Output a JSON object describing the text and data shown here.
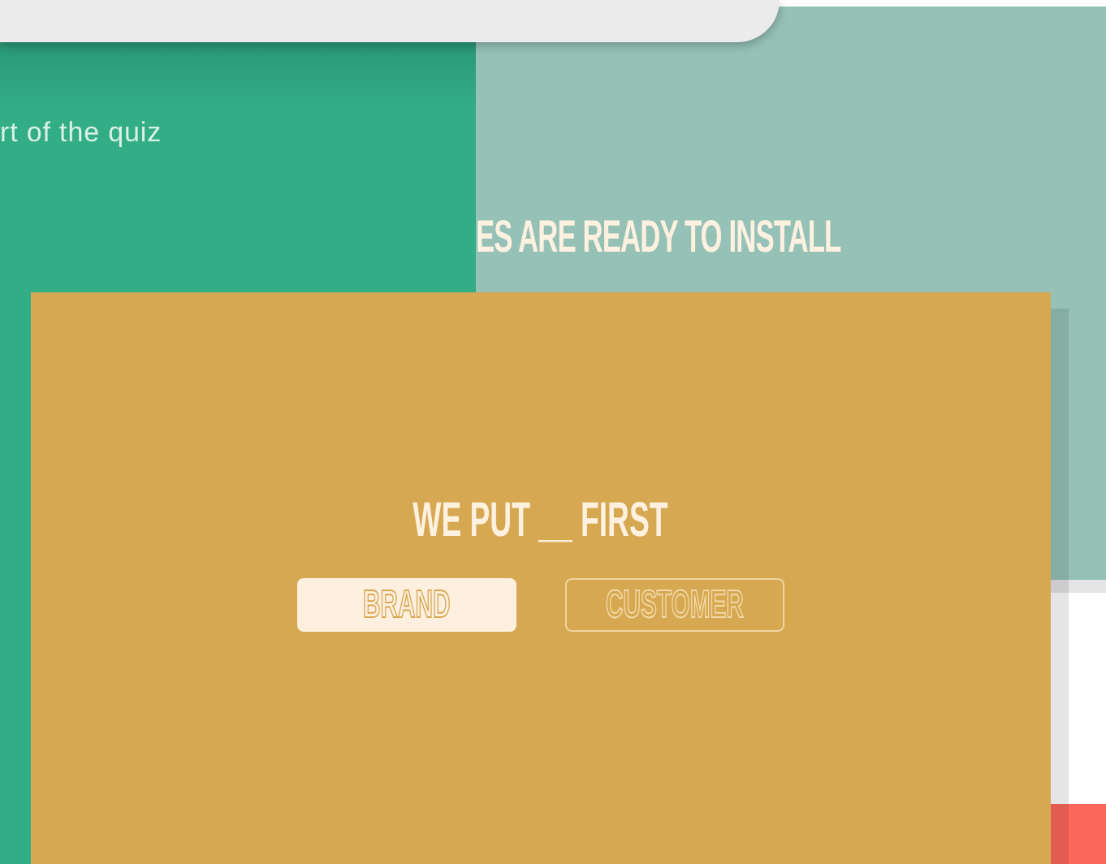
{
  "background_quiz": {
    "subtitle": "rt of the quiz",
    "heading": "ES ARE READY TO INSTALL"
  },
  "question_card": {
    "question": "WE PUT __ FIRST",
    "options": [
      {
        "label": "BRAND",
        "selected": true
      },
      {
        "label": "CUSTOMER",
        "selected": false
      }
    ]
  }
}
